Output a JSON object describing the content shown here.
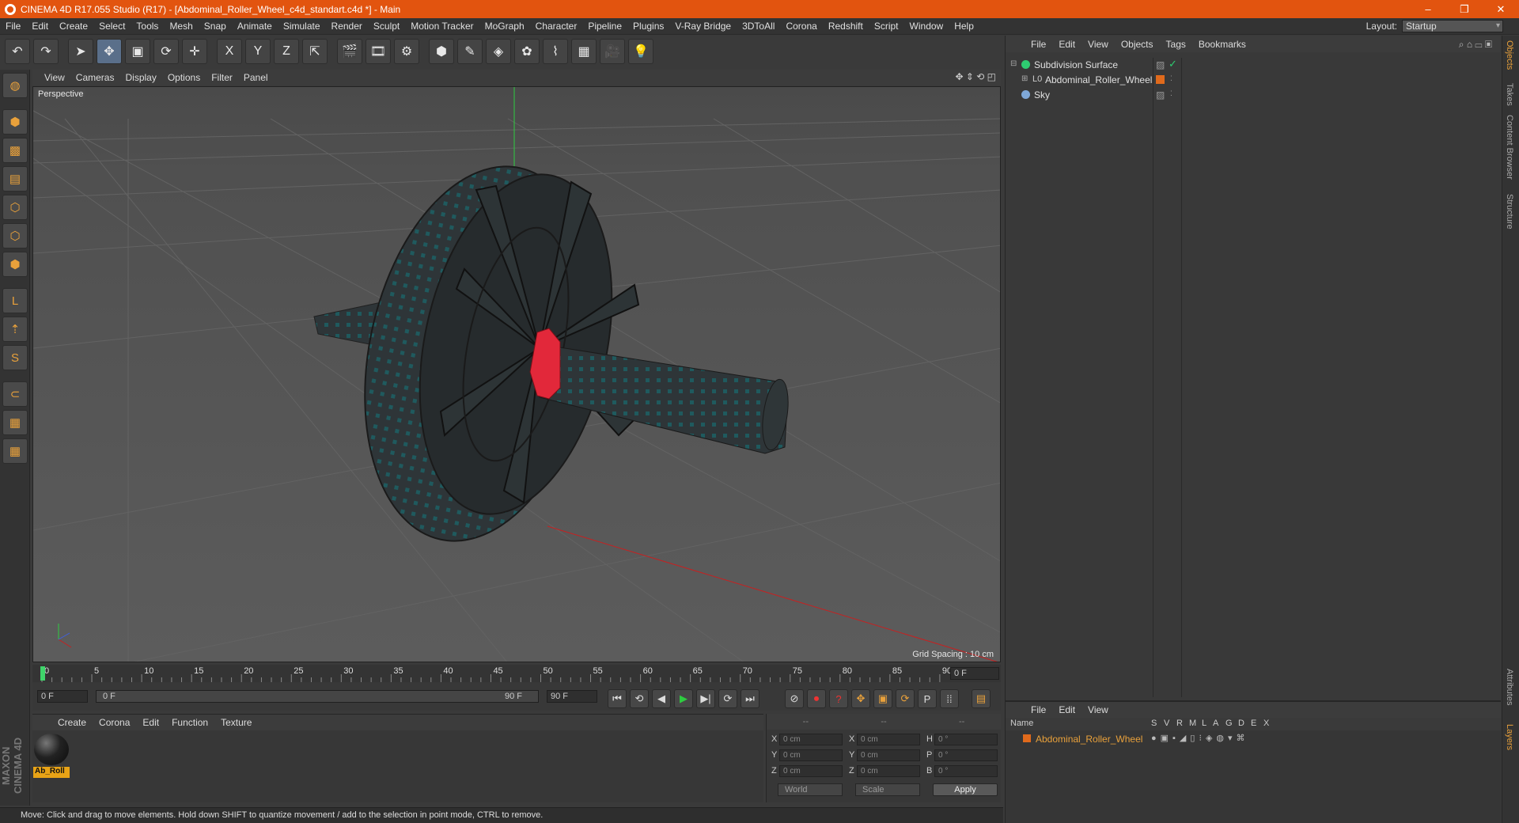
{
  "window": {
    "title": "CINEMA 4D R17.055 Studio (R17) - [Abdominal_Roller_Wheel_c4d_standart.c4d *] - Main",
    "minimize": "–",
    "maximize": "❐",
    "close": "✕"
  },
  "menubar": [
    "File",
    "Edit",
    "Create",
    "Select",
    "Tools",
    "Mesh",
    "Snap",
    "Animate",
    "Simulate",
    "Render",
    "Sculpt",
    "Motion Tracker",
    "MoGraph",
    "Character",
    "Pipeline",
    "Plugins",
    "V-Ray Bridge",
    "3DToAll",
    "Corona",
    "Redshift",
    "Script",
    "Window",
    "Help"
  ],
  "layout": {
    "label": "Layout:",
    "value": "Startup"
  },
  "toolbar": {
    "undo": "↶",
    "redo": "↷",
    "select": "➤",
    "move": "✥",
    "scale": "▣",
    "rotate": "⟳",
    "plus": "✛",
    "axis_x": "X",
    "axis_y": "Y",
    "axis_z": "Z",
    "coord": "⇱",
    "render_view": "🎬",
    "render": "🎞",
    "render_settings": "⚙",
    "cube": "⬢",
    "pen": "✎",
    "subdiv": "◈",
    "array": "✿",
    "deform": "⌇",
    "floor": "▦",
    "camera": "🎥",
    "light": "💡"
  },
  "viewport": {
    "menu": [
      "View",
      "Cameras",
      "Display",
      "Options",
      "Filter",
      "Panel"
    ],
    "label": "Perspective",
    "grid_spacing": "Grid Spacing : 10 cm",
    "nav_icons": "✥ ⇕ ⟲ ◰"
  },
  "timeline": {
    "ticks": [
      "0",
      "5",
      "10",
      "15",
      "20",
      "25",
      "30",
      "35",
      "40",
      "45",
      "50",
      "55",
      "60",
      "65",
      "70",
      "75",
      "80",
      "85",
      "90"
    ],
    "current": "0 F",
    "start": "0 F",
    "range_start": "0 F",
    "range_end": "90 F",
    "end": "90 F"
  },
  "transport": [
    "⏮",
    "⟲",
    "◀",
    "▶",
    "▶|",
    "⟳",
    "⏭"
  ],
  "keytools": [
    "⊘",
    "⏺",
    "?",
    "✥",
    "▣",
    "⟳",
    "P",
    "⁞⁞"
  ],
  "materials": {
    "menu": [
      "Create",
      "Corona",
      "Edit",
      "Function",
      "Texture"
    ],
    "items": [
      {
        "name": "Ab_Roll"
      }
    ]
  },
  "coordinates": {
    "headers": [
      "--",
      "--",
      "--"
    ],
    "rows": [
      {
        "a": "X",
        "av": "0 cm",
        "b": "X",
        "bv": "0 cm",
        "c": "H",
        "cv": "0 °"
      },
      {
        "a": "Y",
        "av": "0 cm",
        "b": "Y",
        "bv": "0 cm",
        "c": "P",
        "cv": "0 °"
      },
      {
        "a": "Z",
        "av": "0 cm",
        "b": "Z",
        "bv": "0 cm",
        "c": "B",
        "cv": "0 °"
      }
    ],
    "world": "World",
    "scale": "Scale",
    "apply": "Apply"
  },
  "status": "Move: Click and drag to move elements. Hold down SHIFT to quantize movement / add to the selection in point mode, CTRL to remove.",
  "objects": {
    "menu": [
      "File",
      "Edit",
      "View",
      "Objects",
      "Tags",
      "Bookmarks"
    ],
    "items": [
      {
        "name": "Subdivision Surface"
      },
      {
        "name": "Abdominal_Roller_Wheel"
      },
      {
        "name": "Sky"
      }
    ]
  },
  "layers": {
    "menu": [
      "File",
      "Edit",
      "View"
    ],
    "columns": [
      "Name",
      "S",
      "V",
      "R",
      "M",
      "L",
      "A",
      "G",
      "D",
      "E",
      "X"
    ],
    "items": [
      {
        "name": "Abdominal_Roller_Wheel"
      }
    ]
  },
  "sidetabs": [
    "Objects",
    "Takes",
    "Content Browser",
    "Structure",
    "Attributes",
    "Layers"
  ],
  "colors": {
    "accent": "#e2540f",
    "selection": "#e9a13b",
    "layer": "#e06a1c"
  },
  "branding": "MAXON CINEMA 4D"
}
